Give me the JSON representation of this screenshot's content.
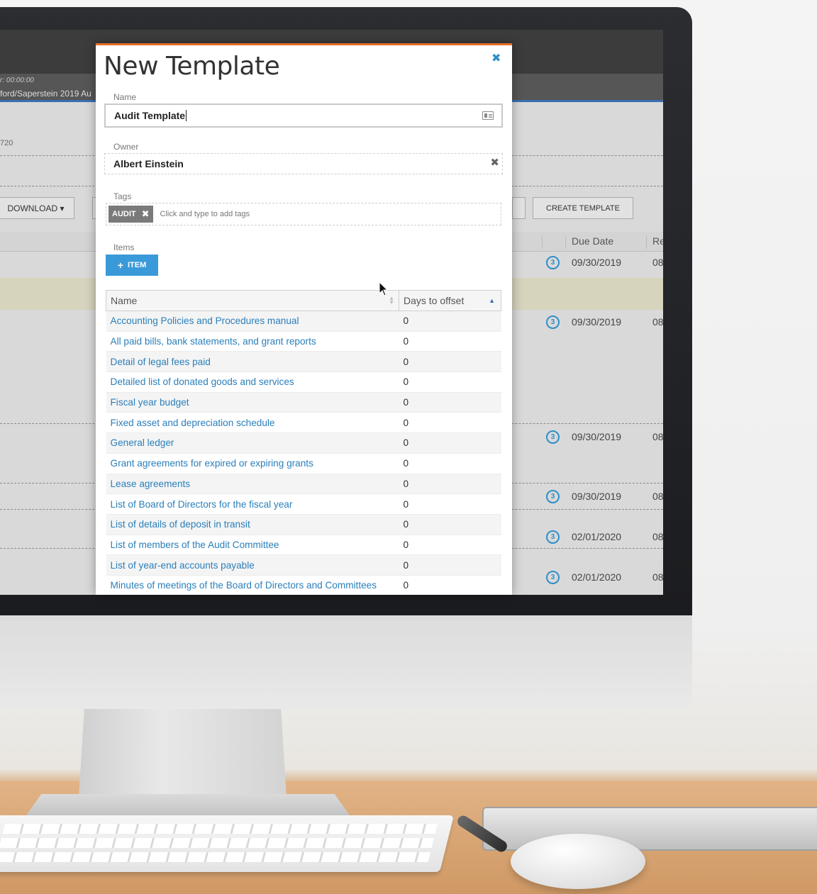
{
  "background_app": {
    "timer": "r: 00:00:00",
    "engagement": "ford/Saperstein 2019 Au",
    "client_number": "720",
    "download_label": "DOWNLOAD ▾",
    "create_template_label": "CREATE TEMPLATE",
    "columns": {
      "due_date": "Due Date",
      "re": "Re"
    },
    "rows": [
      {
        "badge": "3",
        "due_date": "09/30/2019",
        "re": "08"
      },
      {
        "badge": "3",
        "due_date": "09/30/2019",
        "re": "08"
      },
      {
        "badge": "3",
        "due_date": "09/30/2019",
        "re": "08"
      },
      {
        "badge": "3",
        "due_date": "09/30/2019",
        "re": "08"
      },
      {
        "badge": "3",
        "due_date": "02/01/2020",
        "re": "08"
      },
      {
        "badge": "3",
        "due_date": "02/01/2020",
        "re": "08"
      }
    ]
  },
  "modal": {
    "title": "New Template",
    "close_icon": "close-icon",
    "name_label": "Name",
    "name_value": "Audit Template",
    "owner_label": "Owner",
    "owner_value": "Albert Einstein",
    "tags_label": "Tags",
    "tags": [
      "AUDIT"
    ],
    "tags_placeholder": "Click and type to add tags",
    "items_label": "Items",
    "add_item_label": "ITEM",
    "table": {
      "columns": [
        "Name",
        "Days to offset"
      ],
      "rows": [
        {
          "name": "Accounting Policies and Procedures manual",
          "days": "0"
        },
        {
          "name": "All paid bills, bank statements, and grant reports",
          "days": "0"
        },
        {
          "name": "Detail of legal fees paid",
          "days": "0"
        },
        {
          "name": "Detailed list of donated goods and services",
          "days": "0"
        },
        {
          "name": "Fiscal year budget",
          "days": "0"
        },
        {
          "name": "Fixed asset and depreciation schedule",
          "days": "0"
        },
        {
          "name": "General ledger",
          "days": "0"
        },
        {
          "name": "Grant agreements for expired or expiring grants",
          "days": "0"
        },
        {
          "name": "Lease agreements",
          "days": "0"
        },
        {
          "name": "List of Board of Directors for the fiscal year",
          "days": "0"
        },
        {
          "name": "List of details of deposit in transit",
          "days": "0"
        },
        {
          "name": "List of members of the Audit Committee",
          "days": "0"
        },
        {
          "name": "List of year-end accounts payable",
          "days": "0"
        },
        {
          "name": "Minutes of meetings of the Board of Directors and Committees",
          "days": "0"
        }
      ]
    }
  },
  "colors": {
    "accent_orange": "#e8702a",
    "link_blue": "#2a7fba",
    "button_blue": "#3a9ad9",
    "badge_blue": "#2e8fc9"
  }
}
